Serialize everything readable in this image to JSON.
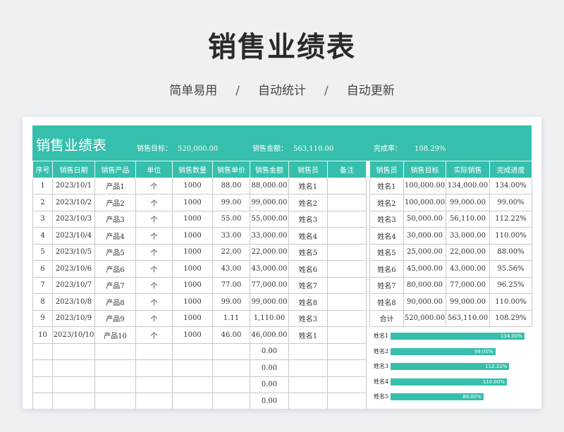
{
  "page": {
    "title": "销售业绩表",
    "subtitle": [
      "简单易用",
      "/",
      "自动统计",
      "/",
      "自动更新"
    ]
  },
  "banner": {
    "title": "销售业绩表",
    "target_label": "销售目标：",
    "target_value": "520,000.00",
    "amount_label": "销售金额：",
    "amount_value": "563,110.00",
    "rate_label": "完成率：",
    "rate_value": "108.29%"
  },
  "main_table": {
    "headers": [
      "序号",
      "销售日期",
      "销售产品",
      "单位",
      "销售数量",
      "销售单价",
      "销售金额",
      "销售员",
      "备注"
    ],
    "rows": [
      [
        "1",
        "2023/10/1",
        "产品1",
        "个",
        "1000",
        "88.00",
        "88,000.00",
        "姓名1",
        ""
      ],
      [
        "2",
        "2023/10/2",
        "产品2",
        "个",
        "1000",
        "99.00",
        "99,000.00",
        "姓名2",
        ""
      ],
      [
        "3",
        "2023/10/3",
        "产品3",
        "个",
        "1000",
        "55.00",
        "55,000.00",
        "姓名3",
        ""
      ],
      [
        "4",
        "2023/10/4",
        "产品4",
        "个",
        "1000",
        "33.00",
        "33,000.00",
        "姓名4",
        ""
      ],
      [
        "5",
        "2023/10/5",
        "产品5",
        "个",
        "1000",
        "22.00",
        "22,000.00",
        "姓名5",
        ""
      ],
      [
        "6",
        "2023/10/6",
        "产品6",
        "个",
        "1000",
        "43.00",
        "43,000.00",
        "姓名6",
        ""
      ],
      [
        "7",
        "2023/10/7",
        "产品7",
        "个",
        "1000",
        "77.00",
        "77,000.00",
        "姓名7",
        ""
      ],
      [
        "8",
        "2023/10/8",
        "产品8",
        "个",
        "1000",
        "99.00",
        "99,000.00",
        "姓名8",
        ""
      ],
      [
        "9",
        "2023/10/9",
        "产品9",
        "个",
        "1000",
        "1.11",
        "1,110.00",
        "姓名3",
        ""
      ],
      [
        "10",
        "2023/10/10",
        "产品10",
        "个",
        "1000",
        "46.00",
        "46,000.00",
        "姓名1",
        ""
      ],
      [
        "",
        "",
        "",
        "",
        "",
        "",
        "0.00",
        "",
        ""
      ],
      [
        "",
        "",
        "",
        "",
        "",
        "",
        "0.00",
        "",
        ""
      ],
      [
        "",
        "",
        "",
        "",
        "",
        "",
        "0.00",
        "",
        ""
      ],
      [
        "",
        "",
        "",
        "",
        "",
        "",
        "0.00",
        "",
        ""
      ]
    ]
  },
  "side_table": {
    "headers": [
      "销售员",
      "销售目标",
      "实际销售",
      "完成进度"
    ],
    "rows": [
      [
        "姓名1",
        "100,000.00",
        "134,000.00",
        "134.00%"
      ],
      [
        "姓名2",
        "100,000.00",
        "99,000.00",
        "99.00%"
      ],
      [
        "姓名3",
        "50,000.00",
        "56,110.00",
        "112.22%"
      ],
      [
        "姓名4",
        "30,000.00",
        "33,000.00",
        "110.00%"
      ],
      [
        "姓名5",
        "25,000.00",
        "22,000.00",
        "88.00%"
      ],
      [
        "姓名6",
        "45,000.00",
        "43,000.00",
        "95.56%"
      ],
      [
        "姓名7",
        "80,000.00",
        "77,000.00",
        "96.25%"
      ],
      [
        "姓名8",
        "90,000.00",
        "99,000.00",
        "110.00%"
      ],
      [
        "合计",
        "520,000.00",
        "563,110.00",
        "108.29%"
      ]
    ]
  },
  "progress_bars": [
    {
      "name": "姓名1",
      "label": "134.00%",
      "fraction": 1.34
    },
    {
      "name": "姓名2",
      "label": "99.00%",
      "fraction": 0.99
    },
    {
      "name": "姓名3",
      "label": "112.22%",
      "fraction": 1.1222
    },
    {
      "name": "姓名4",
      "label": "110.00%",
      "fraction": 1.1
    },
    {
      "name": "姓名5",
      "label": "88.00%",
      "fraction": 0.88
    }
  ],
  "colors": {
    "accent": "#35bfac",
    "background": "#eef0f3"
  }
}
